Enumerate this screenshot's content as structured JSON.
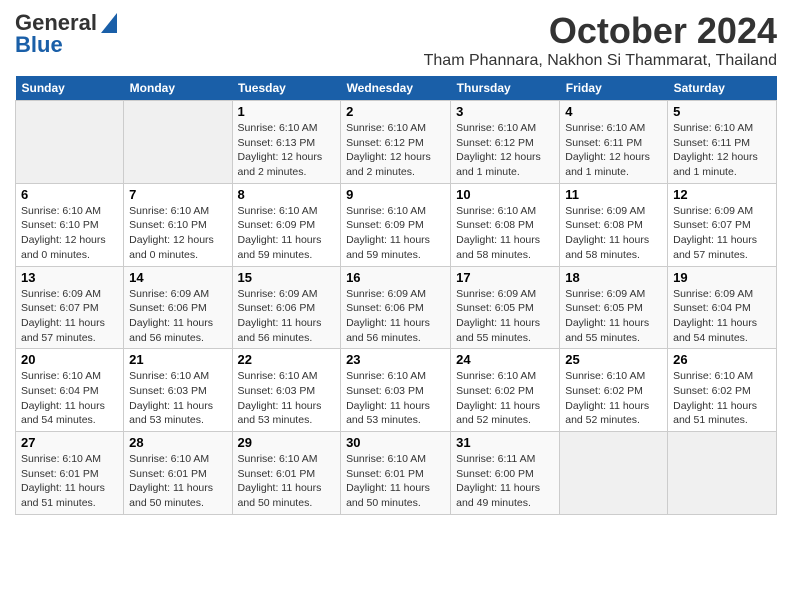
{
  "header": {
    "logo_general": "General",
    "logo_blue": "Blue",
    "month": "October 2024",
    "location": "Tham Phannara, Nakhon Si Thammarat, Thailand"
  },
  "weekdays": [
    "Sunday",
    "Monday",
    "Tuesday",
    "Wednesday",
    "Thursday",
    "Friday",
    "Saturday"
  ],
  "weeks": [
    [
      {
        "day": "",
        "info": ""
      },
      {
        "day": "",
        "info": ""
      },
      {
        "day": "1",
        "info": "Sunrise: 6:10 AM\nSunset: 6:13 PM\nDaylight: 12 hours\nand 2 minutes."
      },
      {
        "day": "2",
        "info": "Sunrise: 6:10 AM\nSunset: 6:12 PM\nDaylight: 12 hours\nand 2 minutes."
      },
      {
        "day": "3",
        "info": "Sunrise: 6:10 AM\nSunset: 6:12 PM\nDaylight: 12 hours\nand 1 minute."
      },
      {
        "day": "4",
        "info": "Sunrise: 6:10 AM\nSunset: 6:11 PM\nDaylight: 12 hours\nand 1 minute."
      },
      {
        "day": "5",
        "info": "Sunrise: 6:10 AM\nSunset: 6:11 PM\nDaylight: 12 hours\nand 1 minute."
      }
    ],
    [
      {
        "day": "6",
        "info": "Sunrise: 6:10 AM\nSunset: 6:10 PM\nDaylight: 12 hours\nand 0 minutes."
      },
      {
        "day": "7",
        "info": "Sunrise: 6:10 AM\nSunset: 6:10 PM\nDaylight: 12 hours\nand 0 minutes."
      },
      {
        "day": "8",
        "info": "Sunrise: 6:10 AM\nSunset: 6:09 PM\nDaylight: 11 hours\nand 59 minutes."
      },
      {
        "day": "9",
        "info": "Sunrise: 6:10 AM\nSunset: 6:09 PM\nDaylight: 11 hours\nand 59 minutes."
      },
      {
        "day": "10",
        "info": "Sunrise: 6:10 AM\nSunset: 6:08 PM\nDaylight: 11 hours\nand 58 minutes."
      },
      {
        "day": "11",
        "info": "Sunrise: 6:09 AM\nSunset: 6:08 PM\nDaylight: 11 hours\nand 58 minutes."
      },
      {
        "day": "12",
        "info": "Sunrise: 6:09 AM\nSunset: 6:07 PM\nDaylight: 11 hours\nand 57 minutes."
      }
    ],
    [
      {
        "day": "13",
        "info": "Sunrise: 6:09 AM\nSunset: 6:07 PM\nDaylight: 11 hours\nand 57 minutes."
      },
      {
        "day": "14",
        "info": "Sunrise: 6:09 AM\nSunset: 6:06 PM\nDaylight: 11 hours\nand 56 minutes."
      },
      {
        "day": "15",
        "info": "Sunrise: 6:09 AM\nSunset: 6:06 PM\nDaylight: 11 hours\nand 56 minutes."
      },
      {
        "day": "16",
        "info": "Sunrise: 6:09 AM\nSunset: 6:06 PM\nDaylight: 11 hours\nand 56 minutes."
      },
      {
        "day": "17",
        "info": "Sunrise: 6:09 AM\nSunset: 6:05 PM\nDaylight: 11 hours\nand 55 minutes."
      },
      {
        "day": "18",
        "info": "Sunrise: 6:09 AM\nSunset: 6:05 PM\nDaylight: 11 hours\nand 55 minutes."
      },
      {
        "day": "19",
        "info": "Sunrise: 6:09 AM\nSunset: 6:04 PM\nDaylight: 11 hours\nand 54 minutes."
      }
    ],
    [
      {
        "day": "20",
        "info": "Sunrise: 6:10 AM\nSunset: 6:04 PM\nDaylight: 11 hours\nand 54 minutes."
      },
      {
        "day": "21",
        "info": "Sunrise: 6:10 AM\nSunset: 6:03 PM\nDaylight: 11 hours\nand 53 minutes."
      },
      {
        "day": "22",
        "info": "Sunrise: 6:10 AM\nSunset: 6:03 PM\nDaylight: 11 hours\nand 53 minutes."
      },
      {
        "day": "23",
        "info": "Sunrise: 6:10 AM\nSunset: 6:03 PM\nDaylight: 11 hours\nand 53 minutes."
      },
      {
        "day": "24",
        "info": "Sunrise: 6:10 AM\nSunset: 6:02 PM\nDaylight: 11 hours\nand 52 minutes."
      },
      {
        "day": "25",
        "info": "Sunrise: 6:10 AM\nSunset: 6:02 PM\nDaylight: 11 hours\nand 52 minutes."
      },
      {
        "day": "26",
        "info": "Sunrise: 6:10 AM\nSunset: 6:02 PM\nDaylight: 11 hours\nand 51 minutes."
      }
    ],
    [
      {
        "day": "27",
        "info": "Sunrise: 6:10 AM\nSunset: 6:01 PM\nDaylight: 11 hours\nand 51 minutes."
      },
      {
        "day": "28",
        "info": "Sunrise: 6:10 AM\nSunset: 6:01 PM\nDaylight: 11 hours\nand 50 minutes."
      },
      {
        "day": "29",
        "info": "Sunrise: 6:10 AM\nSunset: 6:01 PM\nDaylight: 11 hours\nand 50 minutes."
      },
      {
        "day": "30",
        "info": "Sunrise: 6:10 AM\nSunset: 6:01 PM\nDaylight: 11 hours\nand 50 minutes."
      },
      {
        "day": "31",
        "info": "Sunrise: 6:11 AM\nSunset: 6:00 PM\nDaylight: 11 hours\nand 49 minutes."
      },
      {
        "day": "",
        "info": ""
      },
      {
        "day": "",
        "info": ""
      }
    ]
  ]
}
